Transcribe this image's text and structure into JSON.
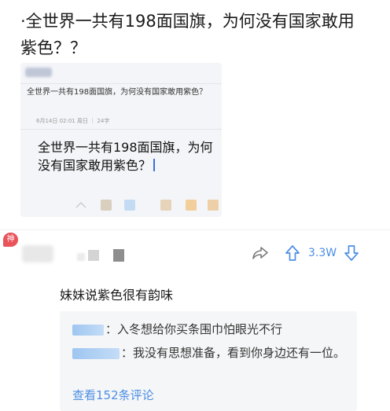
{
  "post": {
    "title": "·全世界一共有198面国旗，为何没有国家敢用紫色？？"
  },
  "screenshot": {
    "small_title": "全世界一共有198面国旗，为何没有国家敢用紫色？",
    "meta": "6月14日 02:01 周日 ｜ 24字",
    "big_text": "全世界一共有198面国旗，为何没有国家敢用紫色？",
    "swatch_colors": [
      "#d8cfbf",
      "#c4dcf3",
      "#e5d4ba",
      "#f2cf9a",
      "#eed0a8"
    ]
  },
  "comment": {
    "badge": "神",
    "vote_count": "3.3W",
    "text": "妹妹说紫色很有韵味",
    "replies": [
      {
        "text": "：入冬想给你买条围巾怕眼光不行"
      },
      {
        "text": "：我没有思想准备，看到你身边还有一位。"
      }
    ],
    "more_label": "查看152条评论"
  },
  "colors": {
    "accent": "#4d8ee6",
    "badge": "#e9545a",
    "reply_bg": "#f5f6f7"
  },
  "icons": [
    "share-icon",
    "upvote-icon",
    "downvote-icon"
  ]
}
